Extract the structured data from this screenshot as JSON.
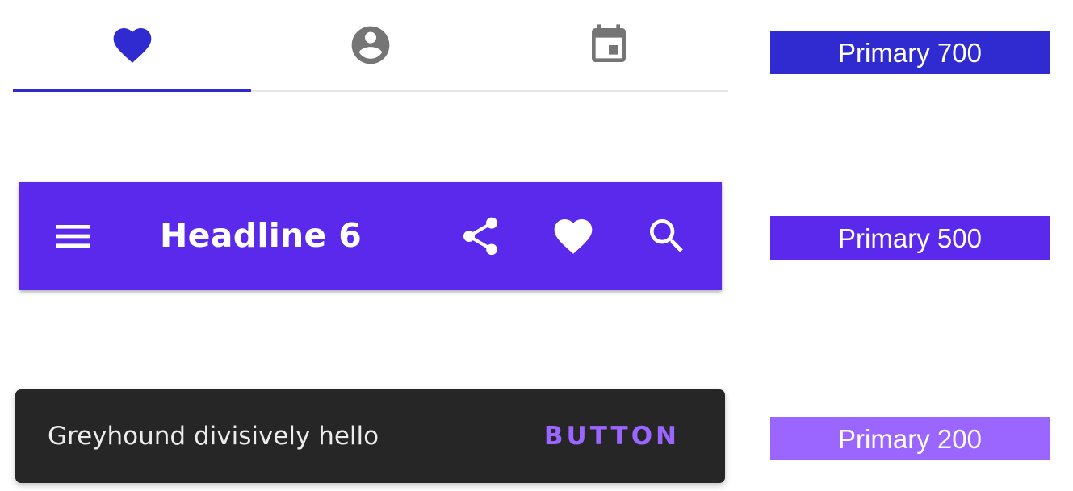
{
  "tabs": {
    "items": [
      {
        "icon": "favorite-icon",
        "selected": true
      },
      {
        "icon": "account-circle-icon",
        "selected": false
      },
      {
        "icon": "calendar-event-icon",
        "selected": false
      }
    ],
    "colors": {
      "selected": "#2f2bd1",
      "unselected": "#757575",
      "indicator": "#2f2bd1",
      "divider": "#e6e6e6"
    }
  },
  "appbar": {
    "title": "Headline 6",
    "background": "#5a29ec",
    "navigation_icon": "menu-icon",
    "actions": [
      "share-icon",
      "favorite-icon",
      "search-icon"
    ]
  },
  "snackbar": {
    "message": "Greyhound divisively hello",
    "action_label": "BUTTON",
    "background": "#262626",
    "action_color": "#9b65ff"
  },
  "swatches": {
    "primary_700": {
      "label": "Primary 700",
      "color": "#2f2bd1"
    },
    "primary_500": {
      "label": "Primary 500",
      "color": "#5a29ec"
    },
    "primary_200": {
      "label": "Primary 200",
      "color": "#9b65ff"
    }
  }
}
